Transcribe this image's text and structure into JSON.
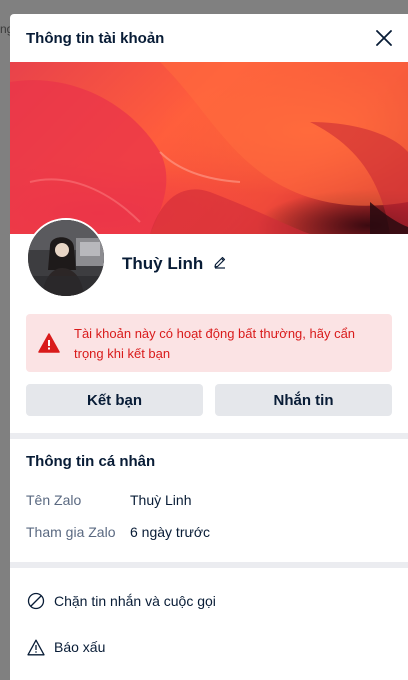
{
  "background": {
    "peek_text": "ng"
  },
  "modal": {
    "title": "Thông tin tài khoản",
    "close_icon": "close-icon"
  },
  "profile": {
    "name": "Thuỳ Linh",
    "edit_icon": "pencil-icon"
  },
  "warning": {
    "text": "Tài khoản này có hoạt động bất thường, hãy cẩn trọng khi kết bạn",
    "icon": "warning-triangle-icon",
    "color": "#d91b1b",
    "background": "#fbe3e4"
  },
  "actions": {
    "add_friend": "Kết bạn",
    "message": "Nhắn tin"
  },
  "personal_info": {
    "title": "Thông tin cá nhân",
    "rows": [
      {
        "label": "Tên Zalo",
        "value": "Thuỳ Linh"
      },
      {
        "label": "Tham gia Zalo",
        "value": "6 ngày trước"
      }
    ]
  },
  "menu": {
    "items": [
      {
        "label": "Chặn tin nhắn và cuộc gọi",
        "icon": "block-icon"
      },
      {
        "label": "Báo xấu",
        "icon": "warning-triangle-icon"
      }
    ]
  }
}
